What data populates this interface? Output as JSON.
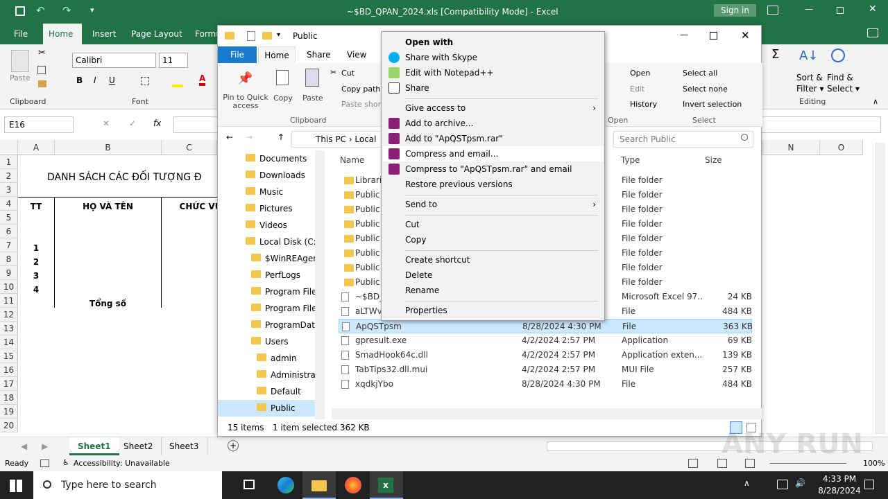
{
  "excel": {
    "title": "~$BD_QPAN_2024.xls  [Compatibility Mode]  -  Excel",
    "signin": "Sign in",
    "tabs": [
      "File",
      "Home",
      "Insert",
      "Page Layout",
      "Formu"
    ],
    "font_name": "Calibri",
    "font_size": "11",
    "clipboard_label": "Clipboard",
    "font_label": "Font",
    "paste_label": "Paste",
    "autosum_items": [
      "Sort &",
      "Filter",
      "Find &",
      "Select"
    ],
    "editing_label": "Editing",
    "namebox": "E16",
    "fx": "fx",
    "columns": [
      "A",
      "B",
      "C",
      "N",
      "O"
    ],
    "rows": [
      "1",
      "2",
      "3",
      "4",
      "5",
      "6",
      "7",
      "8",
      "9",
      "10",
      "11",
      "12",
      "13",
      "14",
      "15",
      "16",
      "17",
      "18",
      "19",
      "20"
    ],
    "cells": {
      "title": "DANH SÁCH CÁC ĐỐI TƯỢNG Đ",
      "tt": "TT",
      "name": "HỌ VÀ TÊN",
      "role": "CHỨC VỤ",
      "r1": "1",
      "r2": "2",
      "r3": "3",
      "r4": "4",
      "total": "Tổng số"
    },
    "sheets": [
      "Sheet1",
      "Sheet2",
      "Sheet3"
    ],
    "status_ready": "Ready",
    "status_access": "Accessibility: Unavailable",
    "zoom": "100%"
  },
  "explorer": {
    "title": "Public",
    "tabs": [
      "File",
      "Home",
      "Share",
      "View"
    ],
    "ribbon": {
      "pin": "Pin to Quick access",
      "copy": "Copy",
      "paste": "Paste",
      "cut": "Cut",
      "copy_path": "Copy path",
      "paste_shortcut": "Paste short",
      "clipboard": "Clipboard",
      "open": "Open",
      "edit": "Edit",
      "history": "History",
      "open_grp": "Open",
      "select_all": "Select all",
      "select_none": "Select none",
      "invert": "Invert selection",
      "select_grp": "Select"
    },
    "breadcrumb": [
      "This PC",
      "Local"
    ],
    "search_placeholder": "Search Public",
    "headers": {
      "name": "Name",
      "type": "Type",
      "size": "Size"
    },
    "nav": [
      "Documents",
      "Downloads",
      "Music",
      "Pictures",
      "Videos",
      "Local Disk (C:)",
      "$WinREAgent",
      "PerfLogs",
      "Program Files",
      "Program Files",
      "ProgramData",
      "Users",
      "admin",
      "Administrat",
      "Default",
      "Public"
    ],
    "files": [
      {
        "name": "Librarie",
        "date": "",
        "type": "File folder",
        "size": ""
      },
      {
        "name": "Public A",
        "date": "",
        "type": "File folder",
        "size": ""
      },
      {
        "name": "Public D",
        "date": "",
        "type": "File folder",
        "size": ""
      },
      {
        "name": "Public D",
        "date": "",
        "type": "File folder",
        "size": ""
      },
      {
        "name": "Public M",
        "date": "",
        "type": "File folder",
        "size": ""
      },
      {
        "name": "Public P",
        "date": "",
        "type": "File folder",
        "size": ""
      },
      {
        "name": "Public P",
        "date": "",
        "type": "File folder",
        "size": ""
      },
      {
        "name": "Public V",
        "date": "",
        "type": "File folder",
        "size": ""
      },
      {
        "name": "~$BD_Q",
        "date": "",
        "type": "Microsoft Excel 97...",
        "size": "24 KB"
      },
      {
        "name": "aLTWvN",
        "date": "",
        "type": "File",
        "size": "484 KB"
      },
      {
        "name": "ApQSTpsm",
        "date": "8/28/2024 4:30 PM",
        "type": "File",
        "size": "363 KB"
      },
      {
        "name": "gpresult.exe",
        "date": "4/2/2024 2:57 PM",
        "type": "Application",
        "size": "69 KB"
      },
      {
        "name": "SmadHook64c.dll",
        "date": "4/2/2024 2:57 PM",
        "type": "Application exten...",
        "size": "139 KB"
      },
      {
        "name": "TabTips32.dll.mui",
        "date": "4/2/2024 2:57 PM",
        "type": "MUI File",
        "size": "257 KB"
      },
      {
        "name": "xqdkjYbo",
        "date": "8/28/2024 4:30 PM",
        "type": "File",
        "size": "484 KB"
      }
    ],
    "status_items": "15 items",
    "status_selected": "1 item selected  362 KB"
  },
  "context_menu": {
    "open_with": "Open with",
    "skype": "Share with Skype",
    "notepad": "Edit with Notepad++",
    "share": "Share",
    "give_access": "Give access to",
    "add_archive": "Add to archive...",
    "add_rar": "Add to \"ApQSTpsm.rar\"",
    "compress_email": "Compress and email...",
    "compress_rar_email": "Compress to \"ApQSTpsm.rar\" and email",
    "restore": "Restore previous versions",
    "send_to": "Send to",
    "cut": "Cut",
    "copy": "Copy",
    "create_shortcut": "Create shortcut",
    "delete": "Delete",
    "rename": "Rename",
    "properties": "Properties"
  },
  "taskbar": {
    "search": "Type here to search",
    "time": "4:33 PM",
    "date": "8/28/2024"
  },
  "watermark": "ANY RUN"
}
